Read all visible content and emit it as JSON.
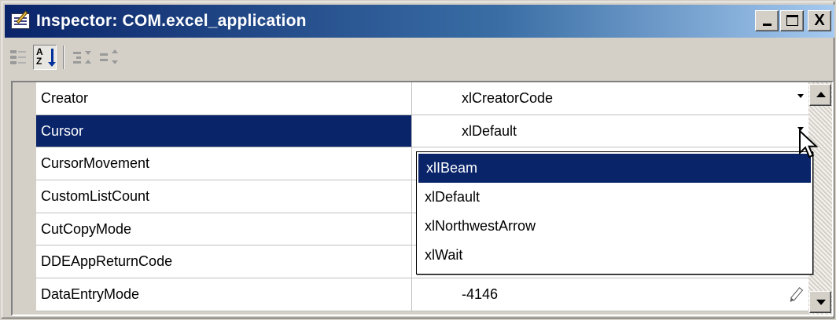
{
  "window": {
    "title": "Inspector: COM.excel_application",
    "minimize_label": "_",
    "maximize_label": "□",
    "close_label": "X"
  },
  "toolbar": {
    "buttons": [
      {
        "name": "categorized-view",
        "icon": "categorized-icon",
        "pressed": false
      },
      {
        "name": "alphabetical-view",
        "icon": "sort-az-icon",
        "label_top": "A",
        "label_bottom": "Z",
        "pressed": true
      },
      {
        "name": "expand-all",
        "icon": "expand-icon",
        "pressed": false
      },
      {
        "name": "collapse-all",
        "icon": "collapse-icon",
        "pressed": false
      }
    ]
  },
  "properties": [
    {
      "name": "Creator",
      "value": "xlCreatorCode",
      "control": "dropdown",
      "selected": false
    },
    {
      "name": "Cursor",
      "value": "xlDefault",
      "control": "dropdown",
      "selected": true
    },
    {
      "name": "CursorMovement",
      "value": "",
      "control": "none",
      "selected": false
    },
    {
      "name": "CustomListCount",
      "value": "",
      "control": "none",
      "selected": false
    },
    {
      "name": "CutCopyMode",
      "value": "",
      "control": "none",
      "selected": false
    },
    {
      "name": "DDEAppReturnCode",
      "value": "",
      "control": "none",
      "selected": false
    },
    {
      "name": "DataEntryMode",
      "value": "-4146",
      "control": "edit",
      "selected": false
    }
  ],
  "dropdown": {
    "options": [
      "xlIBeam",
      "xlDefault",
      "xlNorthwestArrow",
      "xlWait"
    ],
    "highlighted": "xlIBeam"
  },
  "colors": {
    "selection": "#0a246a",
    "title_gradient_start": "#0a246a",
    "title_gradient_end": "#a6caf0",
    "face": "#d4d0c8"
  }
}
